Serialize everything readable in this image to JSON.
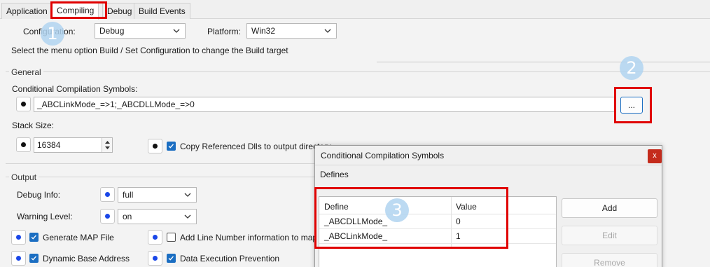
{
  "tabs": [
    "Application",
    "Compiling",
    "Debug",
    "Build Events"
  ],
  "config": {
    "configuration_label": "Configuration:",
    "configuration_value": "Debug",
    "platform_label": "Platform:",
    "platform_value": "Win32",
    "hint": "Select the menu option Build / Set Configuration to change the Build target"
  },
  "general": {
    "title": "General",
    "symbols_label": "Conditional Compilation Symbols:",
    "symbols_value": "_ABCLinkMode_=>1;_ABCDLLMode_=>0",
    "ellipsis_label": "...",
    "stack_label": "Stack Size:",
    "stack_value": "16384",
    "copy_dlls_label": "Copy Referenced Dlls to output directory",
    "copy_dlls_checked": true
  },
  "output": {
    "title": "Output",
    "debug_info_label": "Debug Info:",
    "debug_info_value": "full",
    "warning_level_label": "Warning Level:",
    "warning_level_value": "on",
    "generate_map_label": "Generate MAP File",
    "generate_map_checked": true,
    "line_number_label": "Add Line Number information to map file",
    "line_number_checked": false,
    "dynamic_base_label": "Dynamic Base Address",
    "dynamic_base_checked": true,
    "dep_label": "Data Execution Prevention",
    "dep_checked": true
  },
  "dialog": {
    "title": "Conditional Compilation Symbols",
    "close_label": "x",
    "section_label": "Defines",
    "columns": [
      "Define",
      "Value"
    ],
    "rows": [
      {
        "define": "_ABCDLLMode_",
        "value": "0"
      },
      {
        "define": "_ABCLinkMode_",
        "value": "1"
      }
    ],
    "buttons": {
      "add": "Add",
      "edit": "Edit",
      "remove": "Remove"
    }
  },
  "annotations": [
    "1",
    "2",
    "3"
  ],
  "colors": {
    "highlight": "#e00000",
    "badge": "#b0d3f0",
    "checkbox": "#1b6ec2",
    "radio_dot": "#1a47e8"
  }
}
